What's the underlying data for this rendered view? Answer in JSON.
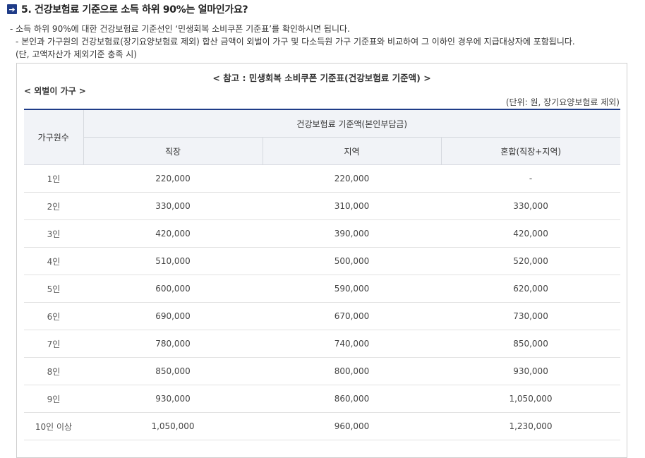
{
  "heading": {
    "icon": "arrow-right-box-icon",
    "title": "5. 건강보험료 기준으로 소득 하위 90%는 얼마인가요?"
  },
  "description": {
    "line1": "- 소득 하위 90%에 대한 건강보험료 기준선인 ‘민생회복 소비쿠폰 기준표’를 확인하시면 됩니다.",
    "line2": "- 본인과 가구원의 건강보험료(장기요양보험료 제외) 합산 금액이 외벌이 가구 및 다소득원 가구 기준표와 비교하여 그 이하인 경우에 지급대상자에 포함됩니다.",
    "line3": "(단, 고액자산가 제외기준 충족 시)"
  },
  "reference": {
    "title": "< 참고 : 민생회복 소비쿠폰 기준표(건강보험료 기준액) >",
    "group_label": "< 외벌이 가구 >",
    "unit": "(단위: 원, 장기요양보험료 제외)"
  },
  "table": {
    "header_household": "가구원수",
    "header_group": "건강보험료 기준액(본인부담금)",
    "columns": [
      "직장",
      "지역",
      "혼합(직장+지역)"
    ],
    "rows": [
      {
        "household": "1인",
        "workplace": "220,000",
        "regional": "220,000",
        "mixed": "-"
      },
      {
        "household": "2인",
        "workplace": "330,000",
        "regional": "310,000",
        "mixed": "330,000"
      },
      {
        "household": "3인",
        "workplace": "420,000",
        "regional": "390,000",
        "mixed": "420,000"
      },
      {
        "household": "4인",
        "workplace": "510,000",
        "regional": "500,000",
        "mixed": "520,000"
      },
      {
        "household": "5인",
        "workplace": "600,000",
        "regional": "590,000",
        "mixed": "620,000"
      },
      {
        "household": "6인",
        "workplace": "690,000",
        "regional": "670,000",
        "mixed": "730,000"
      },
      {
        "household": "7인",
        "workplace": "780,000",
        "regional": "740,000",
        "mixed": "850,000"
      },
      {
        "household": "8인",
        "workplace": "850,000",
        "regional": "800,000",
        "mixed": "930,000"
      },
      {
        "household": "9인",
        "workplace": "930,000",
        "regional": "860,000",
        "mixed": "1,050,000"
      },
      {
        "household": "10인 이상",
        "workplace": "1,050,000",
        "regional": "960,000",
        "mixed": "1,230,000"
      }
    ]
  },
  "colors": {
    "accent": "#1f3c88",
    "header_bg": "#f1f3f7"
  }
}
